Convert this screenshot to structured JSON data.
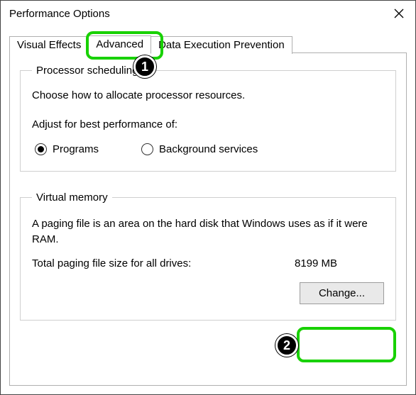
{
  "window": {
    "title": "Performance Options"
  },
  "tabs": {
    "visual_effects": "Visual Effects",
    "advanced": "Advanced",
    "dep": "Data Execution Prevention"
  },
  "processor": {
    "legend": "Processor scheduling",
    "desc": "Choose how to allocate processor resources.",
    "subhead": "Adjust for best performance of:",
    "opt_programs": "Programs",
    "opt_background": "Background services"
  },
  "vm": {
    "legend": "Virtual memory",
    "desc": "A paging file is an area on the hard disk that Windows uses as if it were RAM.",
    "total_label": "Total paging file size for all drives:",
    "total_value": "8199 MB",
    "change_btn": "Change..."
  },
  "annotations": {
    "step1": "1",
    "step2": "2"
  }
}
